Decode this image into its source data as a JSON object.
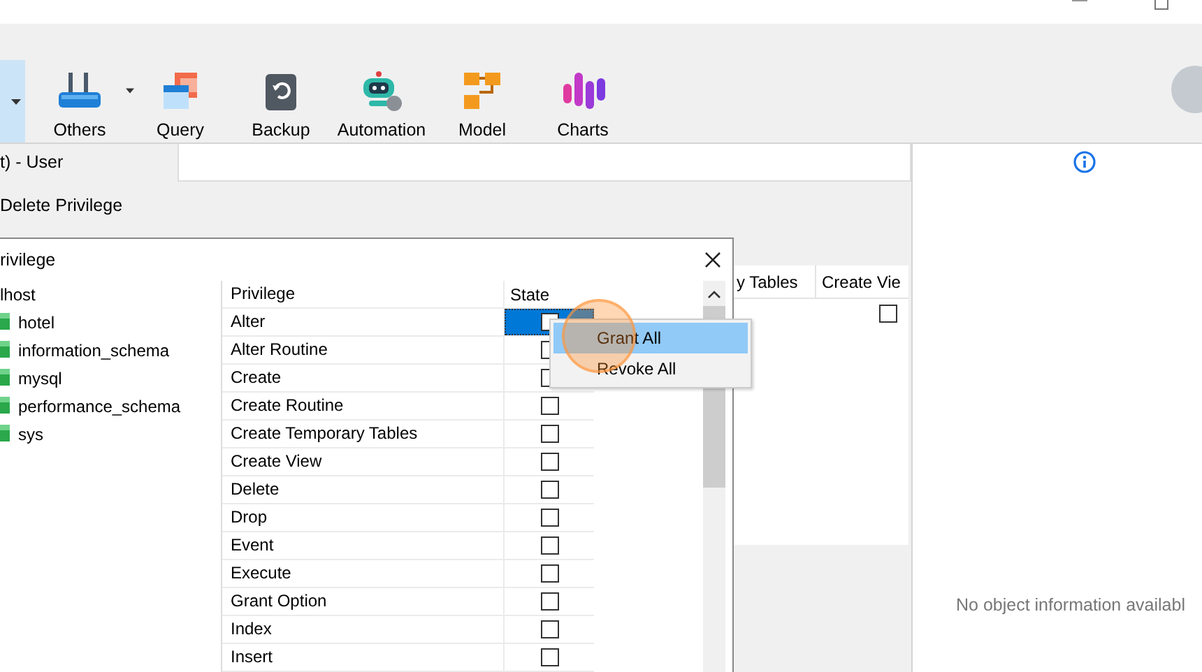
{
  "toolbar": [
    {
      "kind": "partial",
      "selected": true,
      "dropdown": true
    },
    {
      "kind": "tool",
      "label": "Others",
      "selected": false,
      "dropdown": true
    },
    {
      "kind": "tool",
      "label": "Query",
      "selected": false,
      "dropdown": false
    },
    {
      "kind": "tool",
      "label": "Backup",
      "selected": false,
      "dropdown": false
    },
    {
      "kind": "tool",
      "label": "Automation",
      "selected": false,
      "dropdown": false
    },
    {
      "kind": "tool",
      "label": "Model",
      "selected": false,
      "dropdown": false
    },
    {
      "kind": "tool",
      "label": "Charts",
      "selected": false,
      "dropdown": false
    }
  ],
  "editor": {
    "title": "t) - User",
    "action": "Delete Privilege",
    "grid_columns": [
      "y Tables",
      "Create Vie"
    ],
    "grid_rows": [
      {
        "checked": false
      }
    ]
  },
  "dialog": {
    "title": "rivilege",
    "tree": {
      "label": "lhost",
      "children": [
        {
          "label": "hotel"
        },
        {
          "label": "information_schema"
        },
        {
          "label": "mysql"
        },
        {
          "label": "performance_schema"
        },
        {
          "label": "sys"
        }
      ]
    },
    "columns": [
      "Privilege",
      "State"
    ],
    "rows": [
      {
        "privilege": "Alter",
        "checked": false,
        "selected": true
      },
      {
        "privilege": "Alter Routine",
        "checked": false,
        "selected": false
      },
      {
        "privilege": "Create",
        "checked": false,
        "selected": false
      },
      {
        "privilege": "Create Routine",
        "checked": false,
        "selected": false
      },
      {
        "privilege": "Create Temporary Tables",
        "checked": false,
        "selected": false
      },
      {
        "privilege": "Create View",
        "checked": false,
        "selected": false
      },
      {
        "privilege": "Delete",
        "checked": false,
        "selected": false
      },
      {
        "privilege": "Drop",
        "checked": false,
        "selected": false
      },
      {
        "privilege": "Event",
        "checked": false,
        "selected": false
      },
      {
        "privilege": "Execute",
        "checked": false,
        "selected": false
      },
      {
        "privilege": "Grant Option",
        "checked": false,
        "selected": false
      },
      {
        "privilege": "Index",
        "checked": false,
        "selected": false
      },
      {
        "privilege": "Insert",
        "checked": false,
        "selected": false
      }
    ]
  },
  "context_menu": [
    {
      "label": "Grant All",
      "selected": true
    },
    {
      "label": "Revoke All",
      "selected": false
    }
  ],
  "info_panel": {
    "message": "No object information availabl"
  }
}
